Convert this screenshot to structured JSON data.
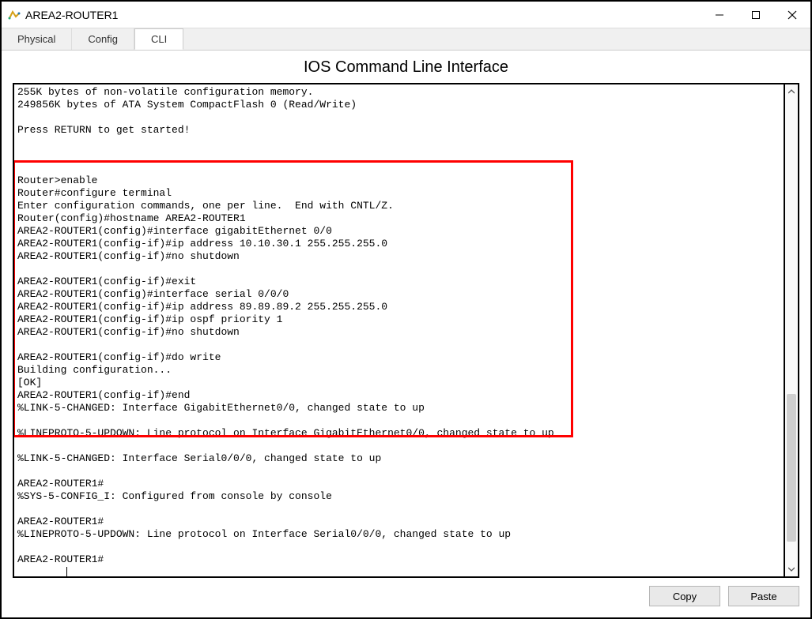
{
  "window": {
    "title": "AREA2-ROUTER1"
  },
  "tabs": {
    "physical": "Physical",
    "config": "Config",
    "cli": "CLI"
  },
  "heading": "IOS Command Line Interface",
  "buttons": {
    "copy": "Copy",
    "paste": "Paste"
  },
  "terminal": {
    "lines": [
      "255K bytes of non-volatile configuration memory.",
      "249856K bytes of ATA System CompactFlash 0 (Read/Write)",
      "",
      "Press RETURN to get started!",
      "",
      "",
      "",
      "Router>enable",
      "Router#configure terminal",
      "Enter configuration commands, one per line.  End with CNTL/Z.",
      "Router(config)#hostname AREA2-ROUTER1",
      "AREA2-ROUTER1(config)#interface gigabitEthernet 0/0",
      "AREA2-ROUTER1(config-if)#ip address 10.10.30.1 255.255.255.0",
      "AREA2-ROUTER1(config-if)#no shutdown",
      "",
      "AREA2-ROUTER1(config-if)#exit",
      "AREA2-ROUTER1(config)#interface serial 0/0/0",
      "AREA2-ROUTER1(config-if)#ip address 89.89.89.2 255.255.255.0",
      "AREA2-ROUTER1(config-if)#ip ospf priority 1",
      "AREA2-ROUTER1(config-if)#no shutdown",
      "",
      "AREA2-ROUTER1(config-if)#do write",
      "Building configuration...",
      "[OK]",
      "AREA2-ROUTER1(config-if)#end",
      "%LINK-5-CHANGED: Interface GigabitEthernet0/0, changed state to up",
      "",
      "%LINEPROTO-5-UPDOWN: Line protocol on Interface GigabitEthernet0/0, changed state to up",
      "",
      "%LINK-5-CHANGED: Interface Serial0/0/0, changed state to up",
      "",
      "AREA2-ROUTER1#",
      "%SYS-5-CONFIG_I: Configured from console by console",
      "",
      "AREA2-ROUTER1#",
      "%LINEPROTO-5-UPDOWN: Line protocol on Interface Serial0/0/0, changed state to up",
      ""
    ],
    "prompt": "AREA2-ROUTER1#"
  }
}
